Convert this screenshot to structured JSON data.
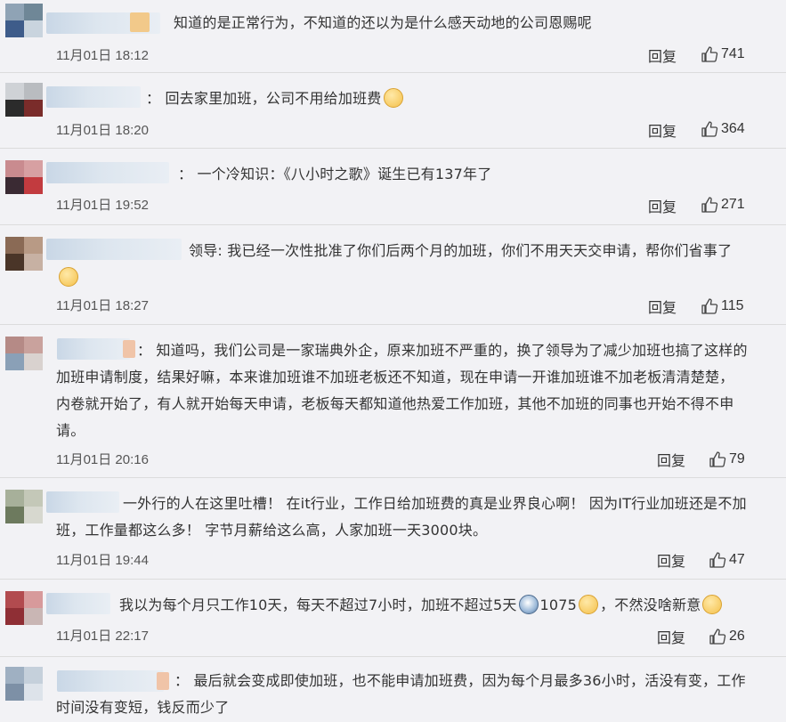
{
  "reply_label": "回复",
  "comments": [
    {
      "text": "知道的是正常行为，不知道的还以为是什么感天动地的公司恩赐呢",
      "time": "11月01日 18:12",
      "likes": "741"
    },
    {
      "text": "： 回去家里加班，公司不用给加班费",
      "time": "11月01日 18:20",
      "likes": "364"
    },
    {
      "text": "： 一个冷知识：《八小时之歌》诞生已有137年了",
      "time": "11月01日 19:52",
      "likes": "271"
    },
    {
      "text": "领导: 我已经一次性批准了你们后两个月的加班，你们不用天天交申请，帮你们省事了",
      "time": "11月01日 18:27",
      "likes": "115"
    },
    {
      "line1": "： 知道吗，我们公司是一家瑞典外企，原来加班不严重的，换了领导为了减少加班也搞了这样的",
      "line2": "加班申请制度，结果好嘛，本来谁加班谁不加班老板还不知道，现在申请一开谁加班谁不加老板清清楚楚，",
      "line3": "内卷就开始了，有人就开始每天申请，老板每天都知道他热爱工作加班，其他不加班的同事也开始不得不申",
      "line4": "请。",
      "time": "11月01日 20:16",
      "likes": "79"
    },
    {
      "line1": "一外行的人在这里吐槽！ 在it行业，工作日给加班费的真是业界良心啊！ 因为IT行业加班还是不加",
      "line2": "班，工作量都这么多！ 字节月薪给这么高，人家加班一天3000块。",
      "time": "11月01日 19:44",
      "likes": "47"
    },
    {
      "text_a": "我以为每个月只工作10天，每天不超过7小时，加班不超过5天",
      "text_b": "1075",
      "text_c": "，不然没啥新意",
      "time": "11月01日 22:17",
      "likes": "26"
    },
    {
      "line1": "： 最后就会变成即使加班，也不能申请加班费，因为每个月最多36小时，活没有变，工作",
      "line2": "时间没有变短，钱反而少了"
    }
  ]
}
